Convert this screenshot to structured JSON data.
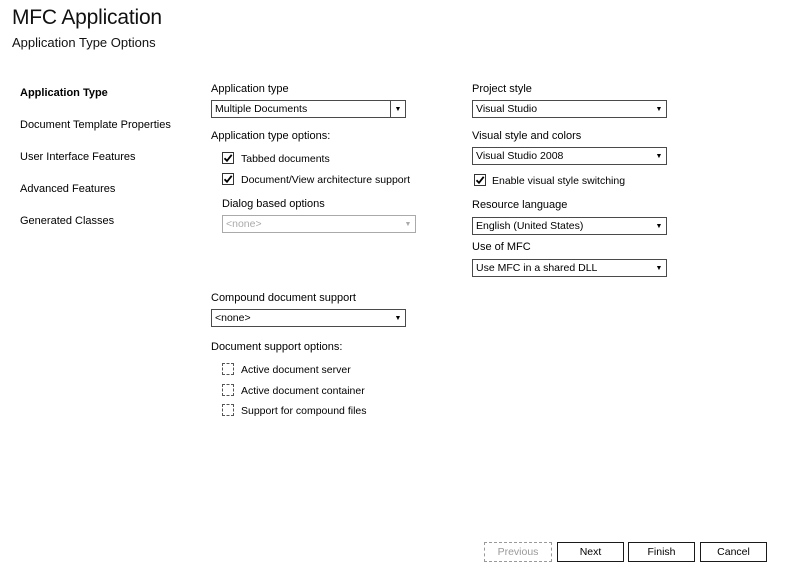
{
  "header": {
    "title": "MFC Application",
    "subtitle": "Application Type Options"
  },
  "nav": {
    "items": [
      "Application Type",
      "Document Template Properties",
      "User Interface Features",
      "Advanced Features",
      "Generated Classes"
    ]
  },
  "left": {
    "app_type_label": "Application type",
    "app_type_value": "Multiple Documents",
    "options_label": "Application type options:",
    "tabbed_label": "Tabbed documents",
    "docview_label": "Document/View architecture support",
    "dialog_label": "Dialog based options",
    "dialog_value": "<none>",
    "compound_label": "Compound document support",
    "compound_value": "<none>",
    "docsupport_label": "Document support options:",
    "active_server_label": "Active document server",
    "active_container_label": "Active document container",
    "compound_files_label": "Support for compound files"
  },
  "right": {
    "project_style_label": "Project style",
    "project_style_value": "Visual Studio",
    "visual_style_label": "Visual style and colors",
    "visual_style_value": "Visual Studio 2008",
    "enable_switch_label": "Enable visual style switching",
    "resource_lang_label": "Resource language",
    "resource_lang_value": "English (United States)",
    "use_mfc_label": "Use of MFC",
    "use_mfc_value": "Use MFC in a shared DLL"
  },
  "buttons": {
    "previous": "Previous",
    "next": "Next",
    "finish": "Finish",
    "cancel": "Cancel"
  },
  "icons": {
    "dropdown": "dropdown-arrow-icon",
    "check": "checkmark-icon"
  }
}
